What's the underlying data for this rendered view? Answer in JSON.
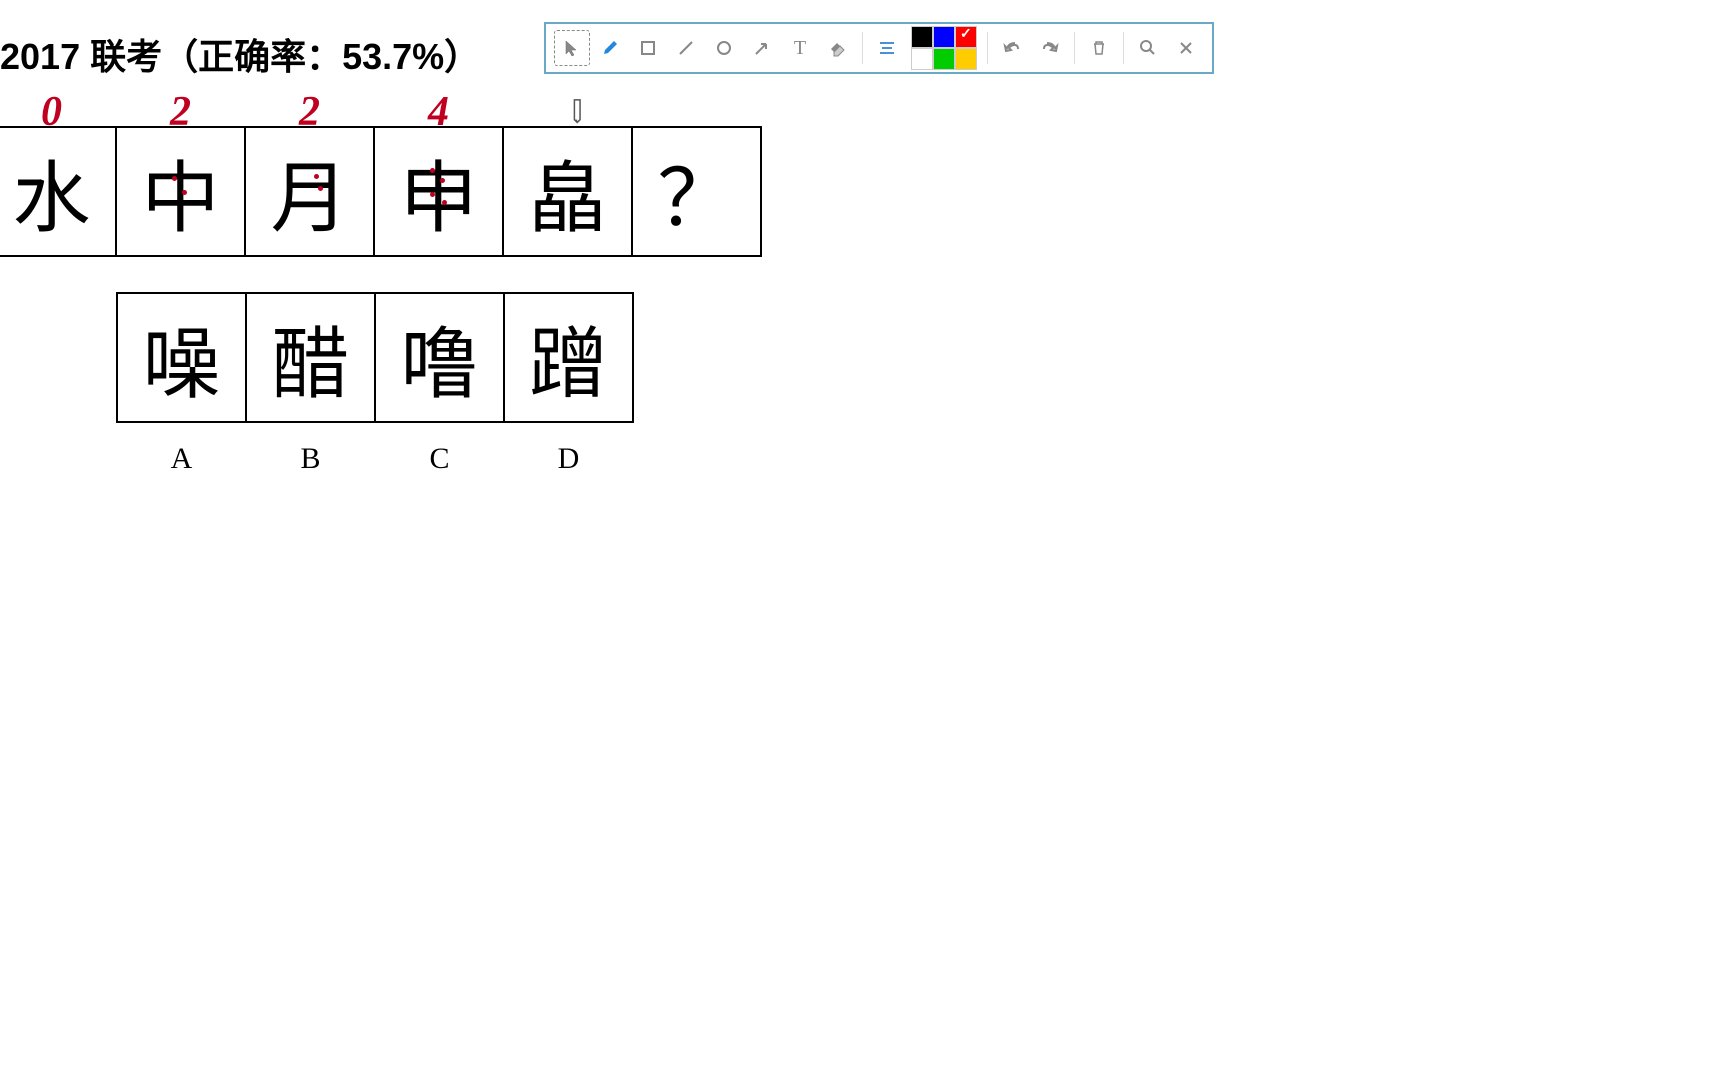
{
  "title": "2017 联考（正确率：53.7%）",
  "toolbar": {
    "tools": [
      "select",
      "pen",
      "rect",
      "line",
      "circle",
      "arrow",
      "text",
      "eraser",
      "align"
    ],
    "colors": [
      {
        "hex": "#000000",
        "checked": false
      },
      {
        "hex": "#0000ff",
        "checked": false
      },
      {
        "hex": "#ff0000",
        "checked": true
      },
      {
        "hex": "#ffffff",
        "checked": false
      },
      {
        "hex": "#00cc00",
        "checked": false
      },
      {
        "hex": "#ffcc00",
        "checked": false
      }
    ],
    "actions": [
      "undo",
      "redo",
      "trash",
      "zoom",
      "close"
    ]
  },
  "annotations": [
    "0",
    "2",
    "2",
    "4",
    "",
    ""
  ],
  "question_chars": [
    "水",
    "中",
    "月",
    "申",
    "皛",
    "？"
  ],
  "options": [
    {
      "char": "噪",
      "label": "A"
    },
    {
      "char": "醋",
      "label": "B"
    },
    {
      "char": "噜",
      "label": "C"
    },
    {
      "char": "蹭",
      "label": "D"
    }
  ]
}
